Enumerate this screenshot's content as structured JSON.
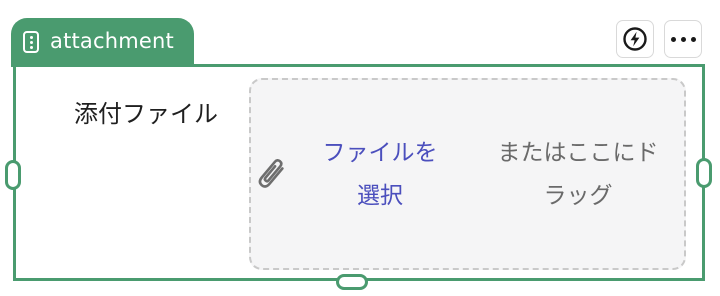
{
  "component": {
    "name": "attachment",
    "icon": "form-field-icon",
    "accent_color": "#4a9b6f"
  },
  "actions": {
    "bolt_icon": "lightning-icon",
    "more_icon": "more-horizontal-icon"
  },
  "field": {
    "label": "添付ファイル"
  },
  "dropzone": {
    "icon": "paperclip-icon",
    "select_line1": "ファイルを",
    "select_line2": "選択",
    "drag_line1": "またはここにド",
    "drag_line2": "ラッグ",
    "link_color": "#4b4fbd",
    "background": "#f5f5f6"
  }
}
